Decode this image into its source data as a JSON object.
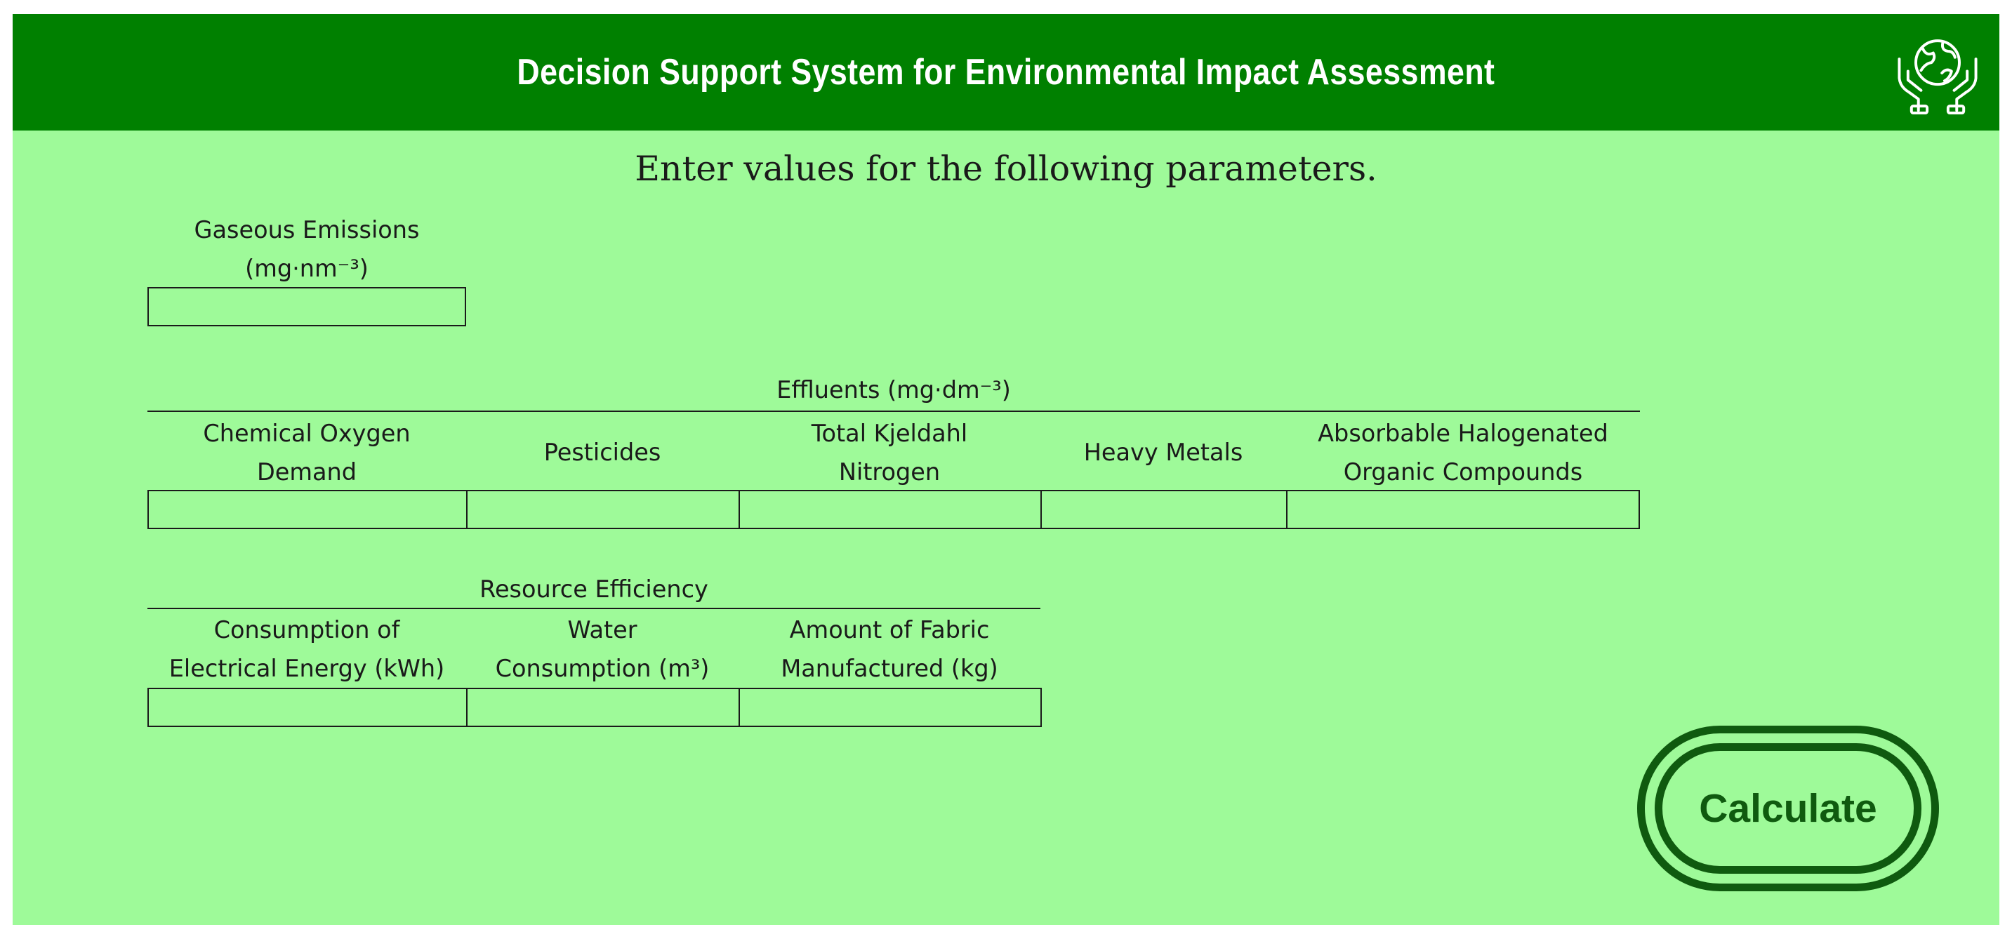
{
  "header": {
    "title": "Decision Support System for Environmental Impact Assessment"
  },
  "colors": {
    "header_green": "#008000",
    "panel_green": "#9efa99",
    "button_green": "#0f5a0f"
  },
  "instruction": "Enter values for the following parameters.",
  "gaseous": {
    "label": "Gaseous Emissions",
    "unit": "(mg·nm⁻³)",
    "value": ""
  },
  "effluents": {
    "title": "Effluents (mg·dm⁻³)",
    "columns": [
      {
        "line1": "Chemical Oxygen",
        "line2": "Demand",
        "value": ""
      },
      {
        "line1": "Pesticides",
        "line2": "",
        "value": ""
      },
      {
        "line1": "Total Kjeldahl",
        "line2": "Nitrogen",
        "value": ""
      },
      {
        "line1": "Heavy Metals",
        "line2": "",
        "value": ""
      },
      {
        "line1": "Absorbable Halogenated",
        "line2": "Organic Compounds",
        "value": ""
      }
    ]
  },
  "resource": {
    "title": "Resource Efficiency",
    "columns": [
      {
        "line1": "Consumption of",
        "line2": "Electrical Energy (kWh)",
        "value": ""
      },
      {
        "line1": "Water",
        "line2": "Consumption (m³)",
        "value": ""
      },
      {
        "line1": "Amount of Fabric",
        "line2": "Manufactured (kg)",
        "value": ""
      }
    ]
  },
  "calculate": {
    "label": "Calculate"
  },
  "icons": {
    "header_logo": "globe-in-hands-icon"
  }
}
